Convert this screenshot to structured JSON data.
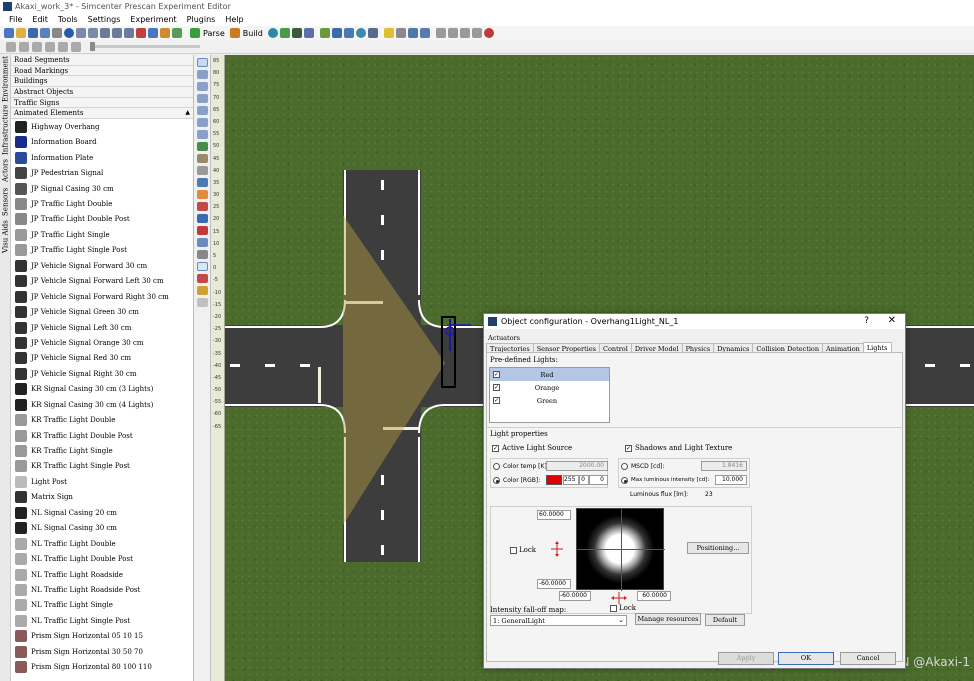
{
  "window": {
    "title": "Akaxi_work_3* - Simcenter Prescan Experiment Editor"
  },
  "menu": [
    "File",
    "Edit",
    "Tools",
    "Settings",
    "Experiment",
    "Plugins",
    "Help"
  ],
  "toolbar": {
    "parse": "Parse",
    "build": "Build"
  },
  "vtabs": [
    "Environment",
    "Infrastructure",
    "Actors",
    "Sensors",
    "Visu Aids"
  ],
  "library": {
    "categories": [
      "Road Segments",
      "Road Markings",
      "Buildings",
      "Abstract Objects",
      "Traffic Signs",
      "Animated Elements"
    ],
    "items": [
      "Highway Overhang",
      "Information Board",
      "Information Plate",
      "JP Pedestrian Signal",
      "JP Signal Casing 30 cm",
      "JP Traffic Light Double",
      "JP Traffic Light Double Post",
      "JP Traffic Light Single",
      "JP Traffic Light Single Post",
      "JP Vehicle Signal Forward 30 cm",
      "JP Vehicle Signal Forward Left 30 cm",
      "JP Vehicle Signal Forward Right 30 cm",
      "JP Vehicle Signal Green 30 cm",
      "JP Vehicle Signal Left 30 cm",
      "JP Vehicle Signal Orange 30 cm",
      "JP Vehicle Signal Red 30 cm",
      "JP Vehicle Signal Right 30 cm",
      "KR Signal Casing 30 cm (3 Lights)",
      "KR Signal Casing 30 cm (4 Lights)",
      "KR Traffic Light Double",
      "KR Traffic Light Double Post",
      "KR Traffic Light Single",
      "KR Traffic Light Single Post",
      "Light Post",
      "Matrix Sign",
      "NL Signal Casing 20 cm",
      "NL Signal Casing 30 cm",
      "NL Traffic Light Double",
      "NL Traffic Light Double Post",
      "NL Traffic Light Roadside",
      "NL Traffic Light Roadside Post",
      "NL Traffic Light Single",
      "NL Traffic Light Single Post",
      "Prism Sign Horizontal 05 10 15",
      "Prism Sign Horizontal 30 50 70",
      "Prism Sign Horizontal 80 100 110"
    ]
  },
  "ruler": [
    "85",
    "80",
    "75",
    "70",
    "65",
    "60",
    "55",
    "50",
    "45",
    "40",
    "35",
    "30",
    "25",
    "20",
    "15",
    "10",
    "5",
    "0",
    "-5",
    "-10",
    "-15",
    "-20",
    "-25",
    "-30",
    "-35",
    "-40",
    "-45",
    "-50",
    "-55",
    "-60",
    "-65"
  ],
  "dialog": {
    "title": "Object configuration - Overhang1Light_NL_1",
    "help": "?",
    "close": "✕",
    "actuators": "Actuators",
    "tabs": [
      "Trajectories",
      "Sensor Properties",
      "Control",
      "Driver Model",
      "Physics",
      "Dynamics",
      "Collision Detection",
      "Animation",
      "Lights"
    ],
    "active_tab": "Lights",
    "predefined_label": "Pre-defined Lights:",
    "lights": [
      {
        "name": "Red",
        "checked": true,
        "selected": true
      },
      {
        "name": "Orange",
        "checked": true,
        "selected": false
      },
      {
        "name": "Green",
        "checked": true,
        "selected": false
      }
    ],
    "light_properties": "Light properties",
    "active_source": "Active Light Source",
    "shadows": "Shadows and Light Texture",
    "color_temp_label": "Color temp [K]:",
    "color_temp": "2000.00",
    "color_rgb_label": "Color [RGB]:",
    "rgb": [
      "255",
      "0",
      "0"
    ],
    "swatch": "#e00000",
    "mscd_label": "MSCD [cd]:",
    "mscd": "1.8416",
    "max_lum_label": "Max luminous intensity [cd]:",
    "max_lum": "10.000",
    "flux_label": "Luminous flux [lm]:",
    "flux": "23",
    "top_angle": "60.0000",
    "bottom_angle": "-60.0000",
    "left_angle": "-60.0000",
    "right_angle": "60.0000",
    "lock": "Lock",
    "positioning": "Positioning...",
    "falloff_label": "Intensity fall-off map:",
    "falloff_value": "1: GeneralLight",
    "manage": "Manage resources",
    "default": "Default",
    "apply": "Apply",
    "ok": "OK",
    "cancel": "Cancel"
  },
  "watermark": "CSDN @Akaxi-1"
}
